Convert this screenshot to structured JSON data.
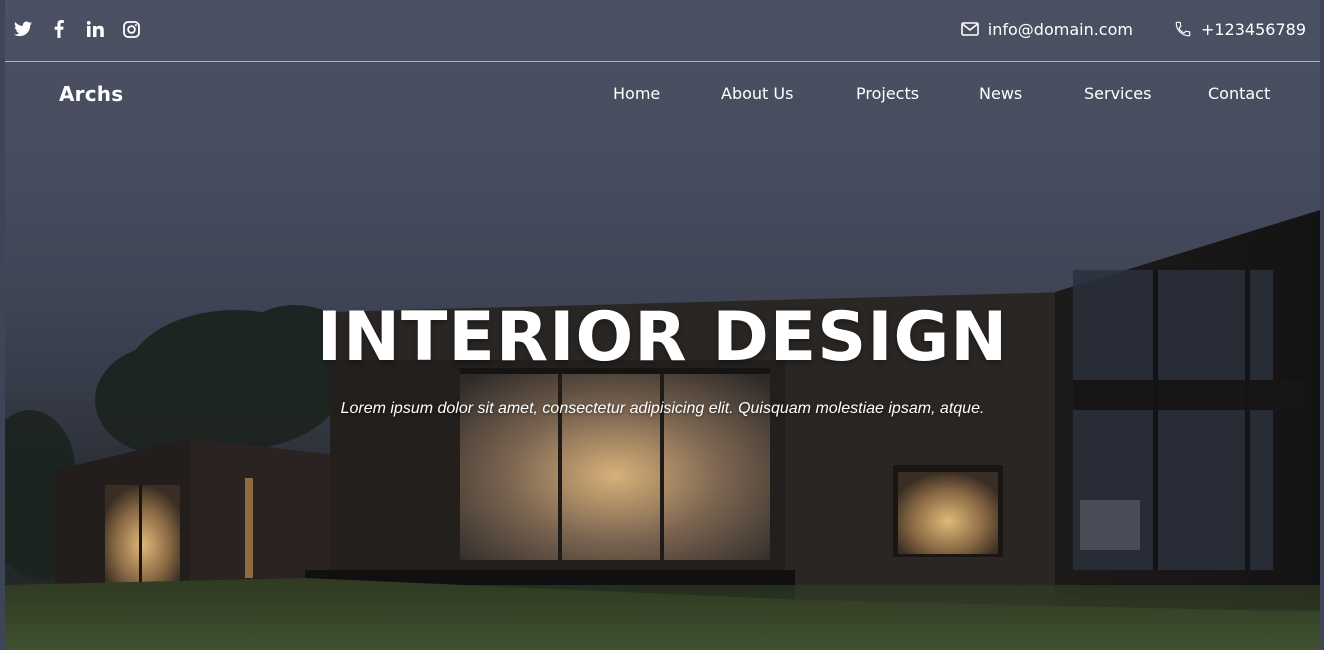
{
  "social": {
    "icons": [
      "twitter-icon",
      "facebook-icon",
      "linkedin-icon",
      "instagram-icon"
    ]
  },
  "contact": {
    "email": "info@domain.com",
    "phone": "+123456789",
    "email_icon": "envelope-icon",
    "phone_icon": "phone-icon"
  },
  "brand": "Archs",
  "nav": {
    "items": [
      {
        "label": "Home"
      },
      {
        "label": "About Us"
      },
      {
        "label": "Projects"
      },
      {
        "label": "News"
      },
      {
        "label": "Services"
      },
      {
        "label": "Contact"
      }
    ]
  },
  "hero": {
    "title": "INTERIOR DESIGN",
    "subtitle": "Lorem ipsum dolor sit amet, consectetur adipisicing elit. Quisquam molestiae ipsam, atque."
  },
  "colors": {
    "sky": "#4b5163",
    "overlay_text": "#ffffff",
    "building": "#1c1917",
    "window_glow": "#c79a5e",
    "grass": "#3b4a2a"
  }
}
